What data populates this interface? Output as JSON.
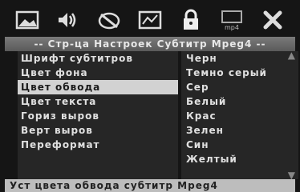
{
  "icons": [
    {
      "name": "picture-icon"
    },
    {
      "name": "audio-icon"
    },
    {
      "name": "subtitle-disc-icon"
    },
    {
      "name": "video-settings-icon"
    },
    {
      "name": "lock-icon"
    },
    {
      "name": "mp4-icon",
      "text": "mp4"
    },
    {
      "name": "close-icon"
    }
  ],
  "title": "-- Стр-ца Настроек Субтитр Mpeg4 --",
  "menu": [
    {
      "label": "Шрифт субтитров"
    },
    {
      "label": "Цвет фона"
    },
    {
      "label": "Цвет обвода"
    },
    {
      "label": "Цвет текста"
    },
    {
      "label": "Гориз выров"
    },
    {
      "label": "Верт выров"
    },
    {
      "label": "Переформат"
    }
  ],
  "options": [
    {
      "label": "Черн"
    },
    {
      "label": "Темно серый"
    },
    {
      "label": "Сер"
    },
    {
      "label": "Белый"
    },
    {
      "label": "Крас"
    },
    {
      "label": "Зелен"
    },
    {
      "label": "Син"
    },
    {
      "label": "Желтый"
    }
  ],
  "status": "Уст цвета обвода субтитр Mpeg4"
}
